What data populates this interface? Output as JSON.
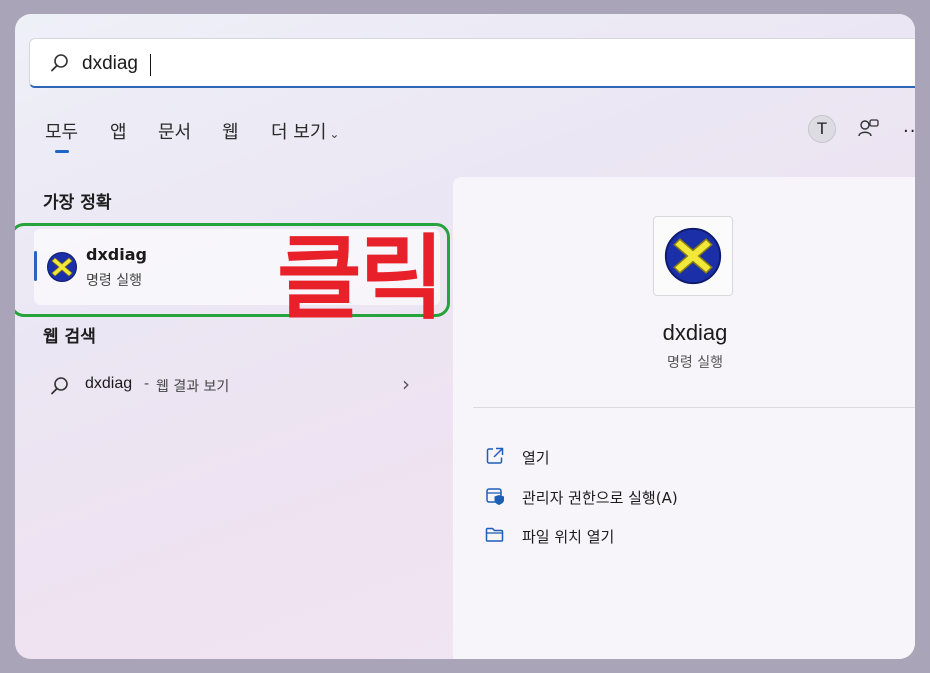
{
  "search": {
    "value": "dxdiag"
  },
  "tabs": [
    {
      "label": "모두"
    },
    {
      "label": "앱"
    },
    {
      "label": "문서"
    },
    {
      "label": "웹"
    },
    {
      "label": "더 보기"
    }
  ],
  "header": {
    "avatar_letter": "T",
    "more": "..."
  },
  "best_match": {
    "title": "가장 정확",
    "name": "dxdiag",
    "type": "명령 실행",
    "annotation": "클릭"
  },
  "web_search": {
    "title": "웹 검색",
    "query": "dxdiag",
    "separator": "-",
    "suffix": "웹 결과 보기",
    "arrow": "›"
  },
  "detail": {
    "name": "dxdiag",
    "type": "명령 실행",
    "actions": [
      {
        "label": "열기",
        "icon": "open-icon"
      },
      {
        "label": "관리자 권한으로 실행(A)",
        "icon": "admin-shield-icon"
      },
      {
        "label": "파일 위치 열기",
        "icon": "folder-icon"
      }
    ]
  },
  "colors": {
    "accent": "#1f63c5",
    "highlight_border": "#26a33a",
    "annotation": "#e8202a"
  }
}
